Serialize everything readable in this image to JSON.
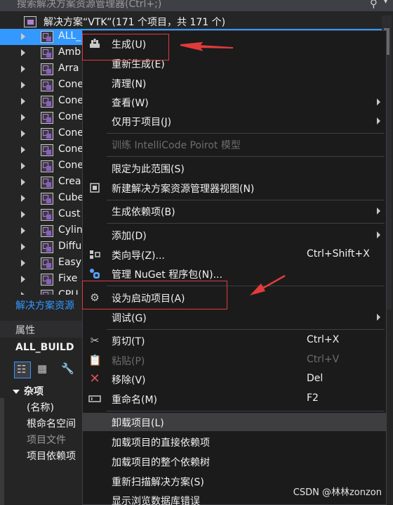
{
  "search": {
    "placeholder": "搜索解决方案资源管理器(Ctrl+;)"
  },
  "solution": {
    "root_label": "解决方案“VTK”(171 个项目，共 171 个)"
  },
  "projects": [
    "ALL_",
    "Amb",
    "Arra",
    "Cone",
    "Cone",
    "Cone",
    "Cone",
    "Cone",
    "Cone",
    "Crea",
    "Cube",
    "Cust",
    "Cylin",
    "Diffu",
    "Easy",
    "Fixe",
    "CPU"
  ],
  "solution_explorer_tab": "解决方案资源",
  "properties": {
    "header": "属性",
    "object": "ALL_BUILD",
    "category": "杂项",
    "rows": [
      "(名称)",
      "根命名空间",
      "项目文件",
      "项目依赖项"
    ]
  },
  "context_menu": {
    "items": [
      {
        "label": "生成(U)",
        "icon": "build-icon"
      },
      {
        "label": "重新生成(E)"
      },
      {
        "label": "清理(N)"
      },
      {
        "label": "查看(W)",
        "submenu": true
      },
      {
        "label": "仅用于项目(J)",
        "submenu": true
      },
      {
        "label": "训练 IntelliCode Poirot 模型",
        "disabled": true
      },
      {
        "label": "限定为此范围(S)"
      },
      {
        "label": "新建解决方案资源管理器视图(N)",
        "icon": "new-view-icon"
      },
      {
        "label": "生成依赖项(B)",
        "submenu": true
      },
      {
        "label": "添加(D)",
        "submenu": true
      },
      {
        "label": "类向导(Z)...",
        "shortcut": "Ctrl+Shift+X",
        "icon": "class-wizard-icon"
      },
      {
        "label": "管理 NuGet 程序包(N)...",
        "icon": "nuget-icon"
      },
      {
        "label": "设为启动项目(A)",
        "icon": "gear-icon"
      },
      {
        "label": "调试(G)",
        "submenu": true
      },
      {
        "label": "剪切(T)",
        "shortcut": "Ctrl+X",
        "icon": "scissors-icon"
      },
      {
        "label": "粘贴(P)",
        "shortcut": "Ctrl+V",
        "disabled": true,
        "icon": "paste-icon"
      },
      {
        "label": "移除(V)",
        "shortcut": "Del",
        "icon": "remove-icon"
      },
      {
        "label": "重命名(M)",
        "shortcut": "F2",
        "icon": "rename-icon"
      },
      {
        "label": "卸载项目(L)"
      },
      {
        "label": "加载项目的直接依赖项"
      },
      {
        "label": "加载项目的整个依赖树"
      },
      {
        "label": "重新扫描解决方案(S)"
      },
      {
        "label": "显示浏览数据库错误"
      }
    ]
  },
  "watermark": "CSDN @林林zonzon",
  "colors": {
    "selection": "#3399ff",
    "annotation_red": "#e23b3b",
    "menu_bg": "#1b1b1c",
    "link": "#3399ff"
  }
}
